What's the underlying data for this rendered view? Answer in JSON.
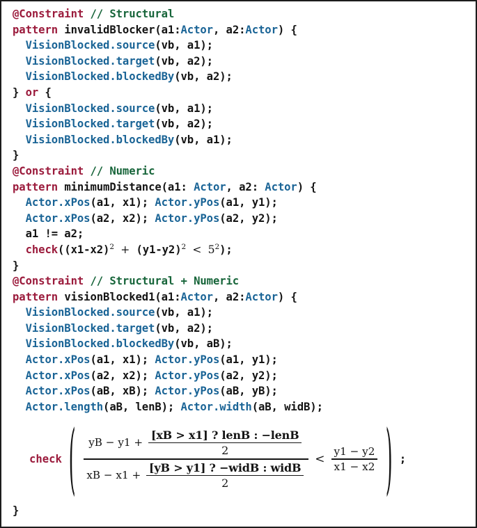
{
  "listing": {
    "language": "VQL graph pattern constraint language",
    "colors": {
      "keyword": "#9b1b3c",
      "comment": "#17653a",
      "type": "#1a6496",
      "text": "#141414",
      "background": "#ffffff",
      "border": "#1c1c1c"
    },
    "lines": [
      {
        "indent": 0,
        "tokens": [
          {
            "t": "@Constraint",
            "c": "kw"
          },
          {
            "t": " ",
            "c": "pun"
          },
          {
            "t": "// Structural",
            "c": "cmt"
          }
        ]
      },
      {
        "indent": 0,
        "tokens": [
          {
            "t": "pattern",
            "c": "kw"
          },
          {
            "t": " invalidBlocker(a1:",
            "c": "pun"
          },
          {
            "t": "Actor",
            "c": "typ"
          },
          {
            "t": ", a2:",
            "c": "pun"
          },
          {
            "t": "Actor",
            "c": "typ"
          },
          {
            "t": ") {",
            "c": "pun"
          }
        ]
      },
      {
        "indent": 1,
        "tokens": [
          {
            "t": "VisionBlocked.source",
            "c": "typ"
          },
          {
            "t": "(vb, a1);",
            "c": "pun"
          }
        ]
      },
      {
        "indent": 1,
        "tokens": [
          {
            "t": "VisionBlocked.target",
            "c": "typ"
          },
          {
            "t": "(vb, a2);",
            "c": "pun"
          }
        ]
      },
      {
        "indent": 1,
        "tokens": [
          {
            "t": "VisionBlocked.blockedBy",
            "c": "typ"
          },
          {
            "t": "(vb, a2);",
            "c": "pun"
          }
        ]
      },
      {
        "indent": 0,
        "tokens": [
          {
            "t": "} ",
            "c": "pun"
          },
          {
            "t": "or",
            "c": "kw"
          },
          {
            "t": " {",
            "c": "pun"
          }
        ]
      },
      {
        "indent": 1,
        "tokens": [
          {
            "t": "VisionBlocked.source",
            "c": "typ"
          },
          {
            "t": "(vb, a1);",
            "c": "pun"
          }
        ]
      },
      {
        "indent": 1,
        "tokens": [
          {
            "t": "VisionBlocked.target",
            "c": "typ"
          },
          {
            "t": "(vb, a2);",
            "c": "pun"
          }
        ]
      },
      {
        "indent": 1,
        "tokens": [
          {
            "t": "VisionBlocked.blockedBy",
            "c": "typ"
          },
          {
            "t": "(vb, a1);",
            "c": "pun"
          }
        ]
      },
      {
        "indent": 0,
        "tokens": [
          {
            "t": "}",
            "c": "pun"
          }
        ]
      },
      {
        "indent": 0,
        "tokens": [
          {
            "t": "@Constraint",
            "c": "kw"
          },
          {
            "t": " ",
            "c": "pun"
          },
          {
            "t": "// Numeric",
            "c": "cmt"
          }
        ]
      },
      {
        "indent": 0,
        "tokens": [
          {
            "t": "pattern",
            "c": "kw"
          },
          {
            "t": " minimumDistance(a1: ",
            "c": "pun"
          },
          {
            "t": "Actor",
            "c": "typ"
          },
          {
            "t": ", a2: ",
            "c": "pun"
          },
          {
            "t": "Actor",
            "c": "typ"
          },
          {
            "t": ") {",
            "c": "pun"
          }
        ]
      },
      {
        "indent": 1,
        "tokens": [
          {
            "t": "Actor.xPos",
            "c": "typ"
          },
          {
            "t": "(a1, x1); ",
            "c": "pun"
          },
          {
            "t": "Actor.yPos",
            "c": "typ"
          },
          {
            "t": "(a1, y1);",
            "c": "pun"
          }
        ]
      },
      {
        "indent": 1,
        "tokens": [
          {
            "t": "Actor.xPos",
            "c": "typ"
          },
          {
            "t": "(a2, x2); ",
            "c": "pun"
          },
          {
            "t": "Actor.yPos",
            "c": "typ"
          },
          {
            "t": "(a2, y2);",
            "c": "pun"
          }
        ]
      },
      {
        "indent": 1,
        "tokens": [
          {
            "t": "a1 != a2;",
            "c": "pun"
          }
        ]
      },
      {
        "indent": 1,
        "special": "numeric-check",
        "text": "check((x1-x2)^2 + (y1-y2)^2 < 5^2);",
        "tokens": [
          {
            "t": "check",
            "c": "kw"
          },
          {
            "t": "((x1-x2)",
            "c": "pun"
          },
          {
            "t": "2",
            "c": "sup"
          },
          {
            "t": " ",
            "c": "pun"
          },
          {
            "t": "+",
            "c": "op"
          },
          {
            "t": " (y1-y2)",
            "c": "pun"
          },
          {
            "t": "2",
            "c": "sup"
          },
          {
            "t": " ",
            "c": "pun"
          },
          {
            "t": "<",
            "c": "op"
          },
          {
            "t": " ",
            "c": "pun"
          },
          {
            "t": "5",
            "c": "mathnum"
          },
          {
            "t": "2",
            "c": "sup"
          },
          {
            "t": ");",
            "c": "pun"
          }
        ]
      },
      {
        "indent": 0,
        "tokens": [
          {
            "t": "}",
            "c": "pun"
          }
        ]
      },
      {
        "indent": 0,
        "tokens": [
          {
            "t": "@Constraint",
            "c": "kw"
          },
          {
            "t": " ",
            "c": "pun"
          },
          {
            "t": "// Structural + Numeric",
            "c": "cmt"
          }
        ]
      },
      {
        "indent": 0,
        "tokens": [
          {
            "t": "pattern",
            "c": "kw"
          },
          {
            "t": " visionBlocked1(a1:",
            "c": "pun"
          },
          {
            "t": "Actor",
            "c": "typ"
          },
          {
            "t": ", a2:",
            "c": "pun"
          },
          {
            "t": "Actor",
            "c": "typ"
          },
          {
            "t": ") {",
            "c": "pun"
          }
        ]
      },
      {
        "indent": 1,
        "tokens": [
          {
            "t": "VisionBlocked.source",
            "c": "typ"
          },
          {
            "t": "(vb, a1);",
            "c": "pun"
          }
        ]
      },
      {
        "indent": 1,
        "tokens": [
          {
            "t": "VisionBlocked.target",
            "c": "typ"
          },
          {
            "t": "(vb, a2);",
            "c": "pun"
          }
        ]
      },
      {
        "indent": 1,
        "tokens": [
          {
            "t": "VisionBlocked.blockedBy",
            "c": "typ"
          },
          {
            "t": "(vb, aB);",
            "c": "pun"
          }
        ]
      },
      {
        "indent": 1,
        "tokens": [
          {
            "t": "Actor.xPos",
            "c": "typ"
          },
          {
            "t": "(a1, x1); ",
            "c": "pun"
          },
          {
            "t": "Actor.yPos",
            "c": "typ"
          },
          {
            "t": "(a1, y1);",
            "c": "pun"
          }
        ]
      },
      {
        "indent": 1,
        "tokens": [
          {
            "t": "Actor.xPos",
            "c": "typ"
          },
          {
            "t": "(a2, x2); ",
            "c": "pun"
          },
          {
            "t": "Actor.yPos",
            "c": "typ"
          },
          {
            "t": "(a2, y2);",
            "c": "pun"
          }
        ]
      },
      {
        "indent": 1,
        "tokens": [
          {
            "t": "Actor.xPos",
            "c": "typ"
          },
          {
            "t": "(aB, xB); ",
            "c": "pun"
          },
          {
            "t": "Actor.yPos",
            "c": "typ"
          },
          {
            "t": "(aB, yB);",
            "c": "pun"
          }
        ]
      },
      {
        "indent": 1,
        "tokens": [
          {
            "t": "Actor.length",
            "c": "typ"
          },
          {
            "t": "(aB, lenB); ",
            "c": "pun"
          },
          {
            "t": "Actor.width",
            "c": "typ"
          },
          {
            "t": "(aB, widB);",
            "c": "pun"
          }
        ]
      },
      {
        "indent": 0,
        "blank": true,
        "tokens": []
      },
      {
        "indent": 0,
        "blank": true,
        "tokens": []
      },
      {
        "indent": 0,
        "blank": true,
        "tokens": []
      },
      {
        "indent": 0,
        "blank": true,
        "tokens": []
      },
      {
        "indent": 0,
        "blank": true,
        "tokens": []
      }
    ]
  },
  "formula": {
    "check_label": "check",
    "open_paren": "(",
    "close_paren": ")",
    "terminator": ";",
    "left": {
      "numerator": {
        "lead": "yB − y1 +",
        "inner_fraction": {
          "numerator": "[xB > x1] ? lenB : −lenB",
          "denominator": "2"
        }
      },
      "denominator": {
        "lead": "xB − x1 +",
        "inner_fraction": {
          "numerator": "[yB > y1] ? −widB : widB",
          "denominator": "2"
        }
      }
    },
    "relation": "<",
    "right": {
      "numerator": "y1 − y2",
      "denominator": "x1 − x2"
    }
  },
  "closing": {
    "final_brace": "}"
  }
}
